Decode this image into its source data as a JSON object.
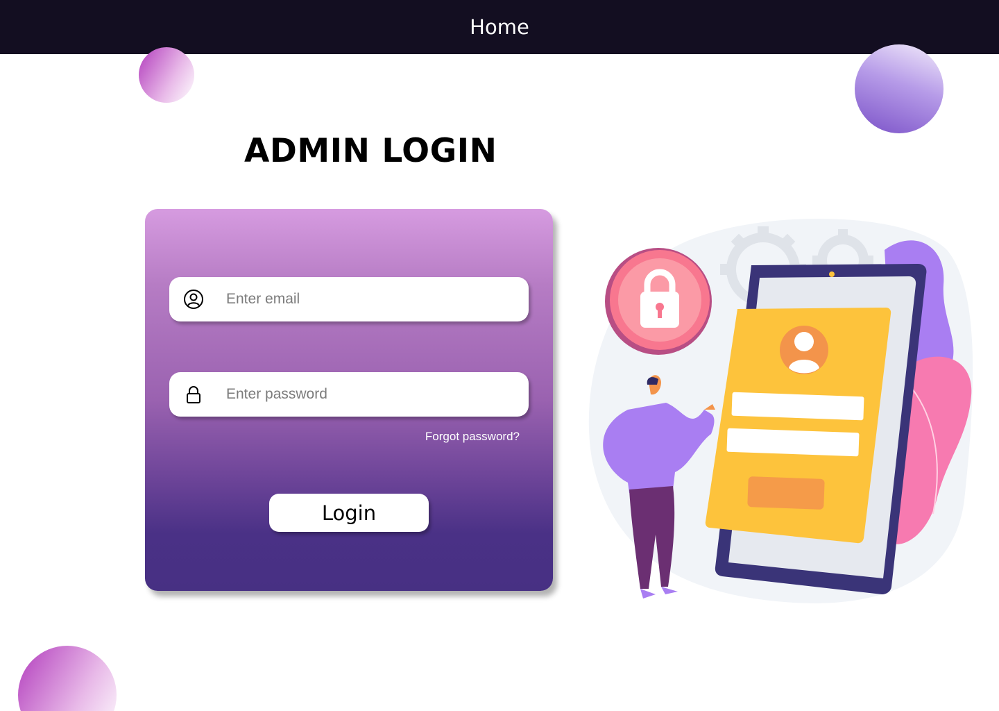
{
  "nav": {
    "home_label": "Home"
  },
  "page": {
    "title": "ADMIN LOGIN"
  },
  "form": {
    "email_placeholder": "Enter email",
    "email_value": "",
    "password_placeholder": "Enter password",
    "password_value": "",
    "forgot_label": "Forgot password?",
    "login_label": "Login"
  },
  "icons": {
    "email": "user-circle-icon",
    "password": "padlock-icon",
    "illustration_lock": "lock-icon",
    "illustration_user": "user-avatar-icon"
  },
  "colors": {
    "topbar": "#130e21",
    "card_top": "#d69be0",
    "card_bottom": "#473083",
    "accent_purple": "#a97ef2",
    "accent_pink": "#f77ab0",
    "accent_yellow": "#fdc33c"
  }
}
